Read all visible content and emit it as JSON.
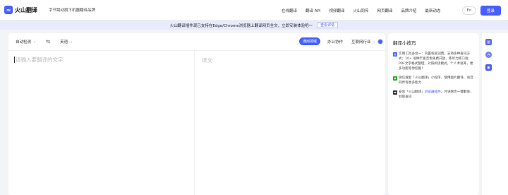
{
  "header": {
    "logo_text": "火山翻译",
    "slogan": "字节跳动旗下机器翻译品牌",
    "nav": [
      "在线翻译",
      "翻译 API",
      "视频翻译",
      "火山同传",
      "网页翻译",
      "品牌介绍",
      "最新动态"
    ],
    "lang_label": "En",
    "login_label": "登录"
  },
  "banner": {
    "text": "火山翻译插件现已支持在Edge/Chrome浏览器上翻译网页全文，立即安装体验吧～",
    "button_label": "查看详情"
  },
  "toolbar": {
    "source_lang": "自动检测",
    "target_lang": "英语",
    "swap_icon": "swap-icon",
    "domain_label": "通用领域",
    "doc_label": "办公协作",
    "industry_label": "互联网行业"
  },
  "editor": {
    "source_placeholder": "请输入要翻译的文字",
    "target_placeholder": "译文"
  },
  "tips": {
    "title": "翻译小技巧",
    "items": [
      {
        "text": "实用工具多合一：内置权威词典，支持多种查词方式；10+ 语种丰富音色免费开放，练听力练口语；PDF文字格式整理，对照阅读模式，个人术语库，更多功能等你挖掘！",
        "color": "#4660ff"
      },
      {
        "text": "微信搜索「火山翻译」小程序，使用图片翻译、语音同传等更多能力",
        "color": "#1aad19"
      },
      {
        "text_before": "安装「火山翻译」",
        "link": "浏览器插件",
        "text_after": "，外语网页一键翻译，划取查词",
        "color": "#333333"
      }
    ]
  },
  "rail": [
    "document-icon",
    "history-icon",
    "collection-icon"
  ]
}
